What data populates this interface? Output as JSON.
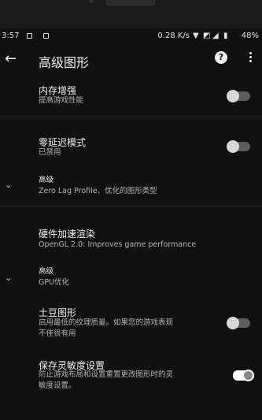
{
  "status_bar": {
    "time": "3:57",
    "net_speed": "0.28 K/s",
    "battery": "48%"
  },
  "app_bar": {
    "title": "高级图形",
    "help_label": "?"
  },
  "settings": {
    "memory": {
      "title": "内存增强",
      "subtitle": "提高游戏性能",
      "enabled": false
    },
    "zero_lag": {
      "title": "零延迟模式",
      "subtitle": "已禁用",
      "enabled": false
    },
    "advanced_1": {
      "title": "高级",
      "subtitle": "Zero Lag Profile、优化的图形类型"
    },
    "hw_accel": {
      "title": "硬件加速渲染",
      "subtitle": "OpenGL 2.0: Improves game performance"
    },
    "advanced_2": {
      "title": "高级",
      "subtitle": "GPU优化"
    },
    "potato": {
      "title": "土豆图形",
      "subtitle_line1": "启用最低的纹理质量。如果您的游戏表现",
      "subtitle_line2": "不佳很有用",
      "enabled": false
    },
    "save_sensitivity": {
      "title": "保存灵敏度设置",
      "subtitle_line1": "防止游戏布局和设置重置更改图形时的灵",
      "subtitle_line2": "敏度设置。",
      "enabled": true
    }
  }
}
